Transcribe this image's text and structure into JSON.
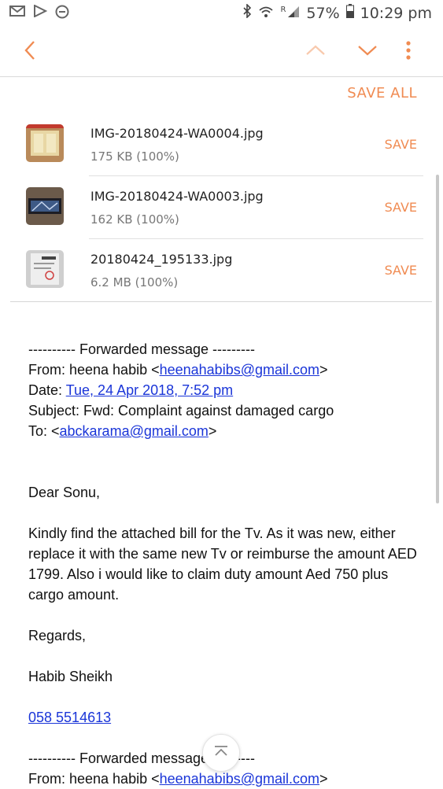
{
  "status_bar": {
    "battery": "57%",
    "time": "10:29 pm",
    "signal_label": "R"
  },
  "toolbar": {
    "accent_color": "#f08b52"
  },
  "attachments": {
    "save_all_label": "SAVE ALL",
    "items": [
      {
        "name": "IMG-20180424-WA0004.jpg",
        "size": "175 KB (100%)",
        "save_label": "SAVE"
      },
      {
        "name": "IMG-20180424-WA0003.jpg",
        "size": "162 KB (100%)",
        "save_label": "SAVE"
      },
      {
        "name": "20180424_195133.jpg",
        "size": "6.2 MB (100%)",
        "save_label": "SAVE"
      }
    ]
  },
  "message": {
    "fwd_header": "---------- Forwarded message ---------",
    "from_label": "From: heena habib <",
    "from_email": "heenahabibs@gmail.com",
    "from_end": ">",
    "date_label": "Date: ",
    "date_value": "Tue, 24 Apr 2018, 7:52 pm",
    "subject": "Subject: Fwd: Complaint against damaged cargo",
    "to_label": "To: <",
    "to_email": "abckarama@gmail.com",
    "to_end": ">",
    "greeting": "Dear Sonu,",
    "body": "Kindly find the attached bill for the Tv. As it was new, either replace it with the same new Tv or reimburse the amount AED 1799. Also i would like to claim duty amount Aed 750 plus cargo amount.",
    "regards": "Regards,",
    "signature": "Habib Sheikh",
    "phone": "058 5514613",
    "fwd_header2": "---------- Forwarded message ---------",
    "from_label2": "From: heena habib <",
    "from_email2": "heenahabibs@gmail.com",
    "from_end2": ">"
  }
}
